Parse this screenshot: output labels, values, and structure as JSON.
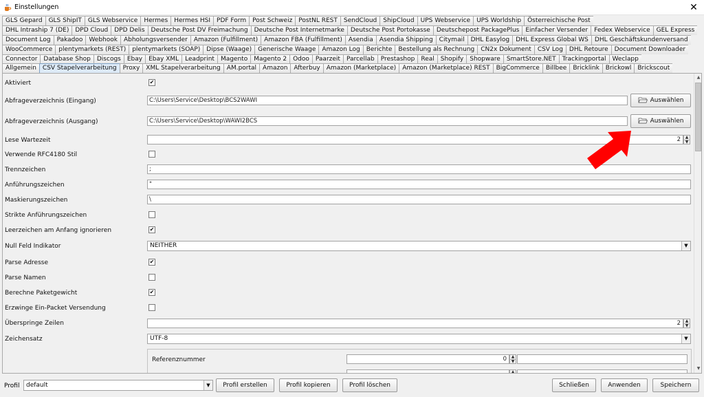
{
  "window": {
    "title": "Einstellungen",
    "icons": {
      "app": "java-cup-icon",
      "close": "close-icon"
    }
  },
  "tabs": {
    "rows": [
      [
        "GLS Gepard",
        "GLS ShipIT",
        "GLS Webservice",
        "Hermes",
        "Hermes HSI",
        "PDF Form",
        "Post Schweiz",
        "PostNL REST",
        "SendCloud",
        "ShipCloud",
        "UPS Webservice",
        "UPS Worldship",
        "Österreichische Post"
      ],
      [
        "DHL Intraship 7 (DE)",
        "DPD Cloud",
        "DPD Delis",
        "Deutsche Post DV Freimachung",
        "Deutsche Post Internetmarke",
        "Deutsche Post Portokasse",
        "Deutschepost PackagePlus",
        "Einfacher Versender",
        "Fedex Webservice",
        "GEL Express"
      ],
      [
        "Document Log",
        "Pakadoo",
        "Webhook",
        "Abholungsversender",
        "Amazon (Fulfillment)",
        "Amazon FBA (Fulfillment)",
        "Asendia",
        "Asendia Shipping",
        "Citymail",
        "DHL Easylog",
        "DHL Express Global WS",
        "DHL Geschäftskundenversand"
      ],
      [
        "WooCommerce",
        "plentymarkets (REST)",
        "plentymarkets (SOAP)",
        "Dipse (Waage)",
        "Generische Waage",
        "Amazon Log",
        "Berichte",
        "Bestellung als Rechnung",
        "CN2x Dokument",
        "CSV Log",
        "DHL Retoure",
        "Document Downloader"
      ],
      [
        "Connector",
        "Database Shop",
        "Discogs",
        "Ebay",
        "Ebay XML",
        "Leadprint",
        "Magento",
        "Magento 2",
        "Odoo",
        "Paarzeit",
        "Parcellab",
        "Prestashop",
        "Real",
        "Shopify",
        "Shopware",
        "SmartStore.NET",
        "Trackingportal",
        "Weclapp"
      ],
      [
        "Allgemein",
        "CSV Stapelverarbeitung",
        "Proxy",
        "XML Stapelverarbeitung",
        "AM.portal",
        "Amazon",
        "Afterbuy",
        "Amazon (Marketplace)",
        "Amazon (Marketplace) REST",
        "BigCommerce",
        "Billbee",
        "Bricklink",
        "Brickowl",
        "Brickscout"
      ]
    ],
    "active": "CSV Stapelverarbeitung"
  },
  "form": {
    "aktiviert": {
      "label": "Aktiviert",
      "checked": true
    },
    "eingang": {
      "label": "Abfrageverzeichnis (Eingang)",
      "value": "C:\\Users\\Service\\Desktop\\BCS2WAWI",
      "button": "Auswählen"
    },
    "ausgang": {
      "label": "Abfrageverzeichnis (Ausgang)",
      "value": "C:\\Users\\Service\\Desktop\\WAWI2BCS",
      "button": "Auswählen"
    },
    "wartezeit": {
      "label": "Lese Wartezeit",
      "value": "2"
    },
    "rfc4180": {
      "label": "Verwende RFC4180 Stil",
      "checked": false
    },
    "trennzeichen": {
      "label": "Trennzeichen",
      "value": ";"
    },
    "anfuehrungszeichen": {
      "label": "Anführungszeichen",
      "value": "\""
    },
    "maskierungszeichen": {
      "label": "Maskierungszeichen",
      "value": "\\"
    },
    "strikte": {
      "label": "Strikte Anführungszeichen",
      "checked": false
    },
    "leerzeichen": {
      "label": "Leerzeichen am Anfang ignorieren",
      "checked": true
    },
    "nullfeld": {
      "label": "Null Feld Indikator",
      "value": "NEITHER"
    },
    "parse_adresse": {
      "label": "Parse Adresse",
      "checked": true
    },
    "parse_namen": {
      "label": "Parse Namen",
      "checked": false
    },
    "paketgewicht": {
      "label": "Berechne Paketgewicht",
      "checked": true
    },
    "einpacket": {
      "label": "Erzwinge Ein-Packet Versendung",
      "checked": false
    },
    "ueberspringe": {
      "label": "Überspringe Zeilen",
      "value": "2"
    },
    "zeichensatz": {
      "label": "Zeichensatz",
      "value": "UTF-8"
    },
    "referenz": {
      "label": "Referenznummer",
      "value": "0"
    }
  },
  "bottom": {
    "profil_label": "Profil",
    "profil_value": "default",
    "buttons": {
      "erstellen": "Profil erstellen",
      "kopieren": "Profil kopieren",
      "loeschen": "Profil löschen",
      "schliessen": "Schließen",
      "anwenden": "Anwenden",
      "speichern": "Speichern"
    }
  },
  "colors": {
    "annotation_arrow": "#ff0000",
    "active_tab": "#ddeaf7"
  }
}
